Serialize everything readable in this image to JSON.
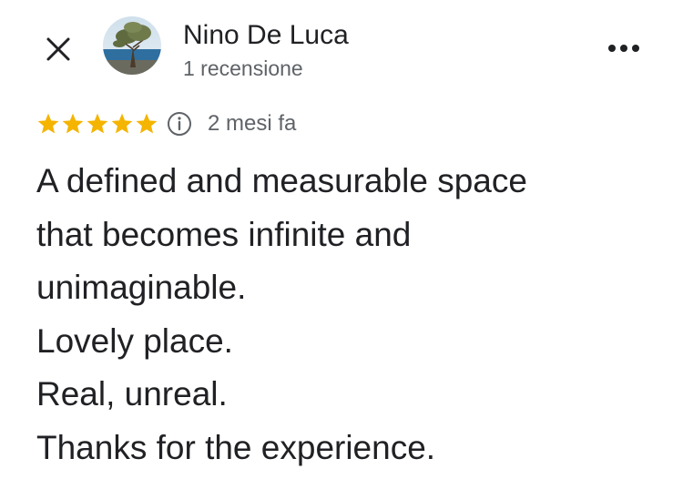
{
  "header": {
    "close_icon": "close-icon",
    "more_icon": "more-horizontal-icon",
    "author": {
      "name": "Nino De Luca",
      "meta": "1 recensione",
      "avatar": "avatar-photo"
    }
  },
  "review": {
    "rating": 5,
    "rating_max": 5,
    "star_color": "#F4B400",
    "info_icon": "info-icon",
    "date": "2 mesi fa",
    "lines": [
      "A defined and measurable space",
      "that becomes infinite and",
      "unimaginable.",
      "Lovely place.",
      "Real, unreal.",
      "Thanks for the experience."
    ]
  }
}
